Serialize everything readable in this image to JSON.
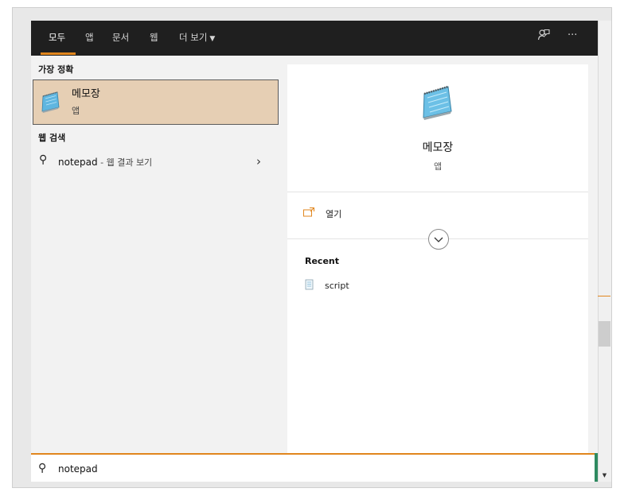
{
  "tabs": [
    {
      "label": "모두",
      "active": true
    },
    {
      "label": "앱"
    },
    {
      "label": "문서"
    },
    {
      "label": "웹"
    },
    {
      "label": "더 보기"
    }
  ],
  "top_icons": [
    "feedback-icon",
    "more-options-icon"
  ],
  "top_more_glyph": "···",
  "best_match": {
    "section": "가장 정확",
    "title": "메모장",
    "subtitle": "앱"
  },
  "web_search": {
    "section": "웹 검색",
    "query": "notepad",
    "suffix": " - 웹 결과 보기"
  },
  "detail": {
    "title": "메모장",
    "subtitle": "앱",
    "open_label": "열기",
    "recent_label": "Recent",
    "recent_items": [
      "script"
    ]
  },
  "search": {
    "value": "notepad"
  },
  "colors": {
    "accent": "#e1861d",
    "topbar": "#1f1f1f",
    "selected": "#e6cfb4",
    "search_edge": "#2e8a60"
  }
}
